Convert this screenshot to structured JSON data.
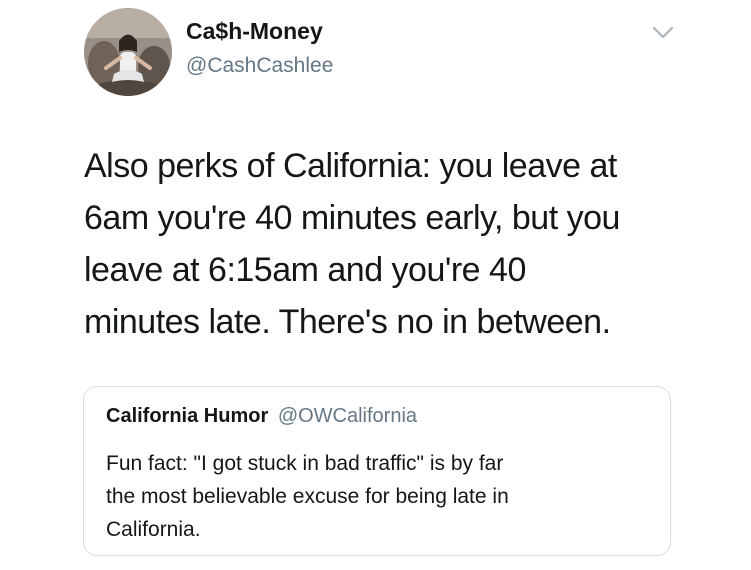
{
  "tweet": {
    "author_name": "Ca$h-Money",
    "author_handle": "@CashCashlee",
    "text": "Also perks of California: you leave at\n6am you're 40 minutes early, but you\nleave at 6:15am and you're 40\nminutes late. There's no in between."
  },
  "quoted_tweet": {
    "author_name": "California Humor",
    "author_handle": "@OWCalifornia",
    "text": "Fun fact: \"I got stuck in bad traffic\" is by far\nthe most believable excuse for being late in\nCalifornia."
  },
  "icons": {
    "menu": "chevron-down-icon"
  },
  "colors": {
    "text": "#14171a",
    "secondary": "#657786",
    "border": "#d8dee3"
  }
}
